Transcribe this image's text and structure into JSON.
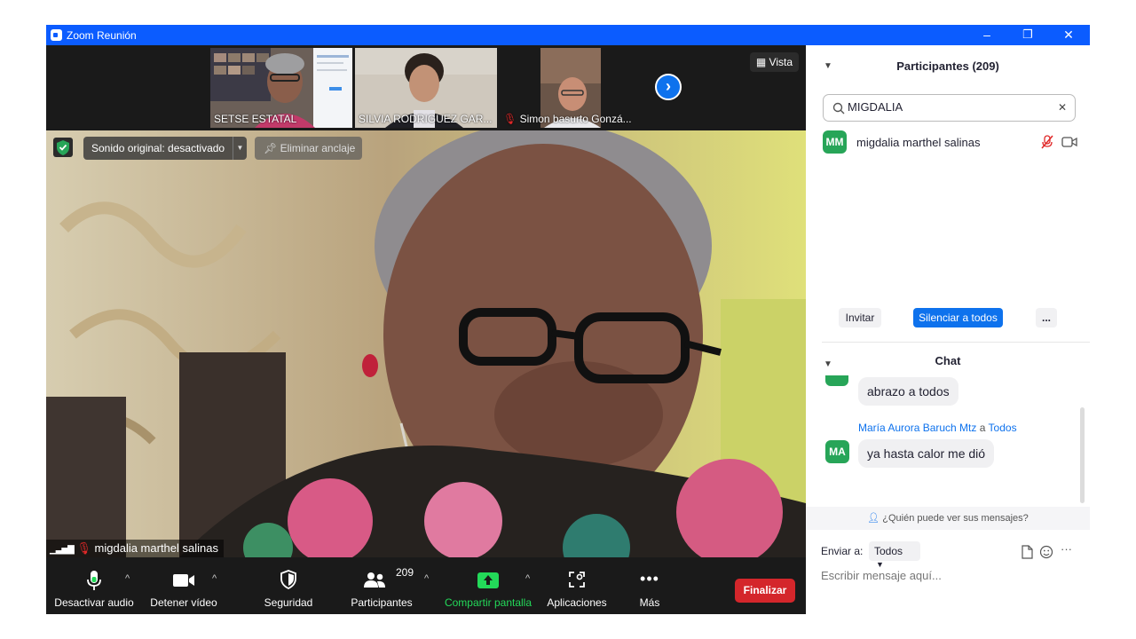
{
  "window": {
    "title": "Zoom Reunión",
    "minimize": "–",
    "restore": "❐",
    "close": "✕"
  },
  "video": {
    "thumbnails": [
      {
        "name": "SETSE ESTATAL",
        "muted": false
      },
      {
        "name": "SILVIA RODRIGUEZ GAR...",
        "muted": false
      },
      {
        "name": "Simon basurto Gonzá...",
        "muted": true
      }
    ],
    "view_label": "Vista",
    "next_arrow": "›",
    "sound_chip": "Sonido original: desactivado",
    "unpin_label": "Eliminar anclaje",
    "speaker_name": "migdalia marthel salinas"
  },
  "toolbar": {
    "audio": "Desactivar audio",
    "video": "Detener vídeo",
    "security": "Seguridad",
    "participants": "Participantes",
    "participants_count": "209",
    "share": "Compartir pantalla",
    "apps": "Aplicaciones",
    "more": "Más",
    "end": "Finalizar",
    "caret": "^"
  },
  "participants_panel": {
    "title": "Participantes (209)",
    "search_value": "MIGDALIA",
    "clear": "✕",
    "results": [
      {
        "initials": "MM",
        "name": "migdalia marthel salinas"
      }
    ],
    "invite": "Invitar",
    "mute_all": "Silenciar a todos",
    "more": "..."
  },
  "chat": {
    "title": "Chat",
    "messages": [
      {
        "text": "abrazo a todos"
      },
      {
        "sender": "María Aurora Baruch Mtz",
        "to_word": "a",
        "recipient": "Todos",
        "initials": "MA",
        "text": "ya hasta calor me dió"
      }
    ],
    "who_sees": "¿Quién puede ver sus mensajes?",
    "send_to_label": "Enviar a:",
    "send_to_value": "Todos",
    "placeholder": "Escribir mensaje aquí..."
  },
  "colors": {
    "accent": "#0e72ed",
    "titlebar": "#0b5cff",
    "end": "#d4262b",
    "share": "#23d959",
    "avatar": "#27a558"
  }
}
